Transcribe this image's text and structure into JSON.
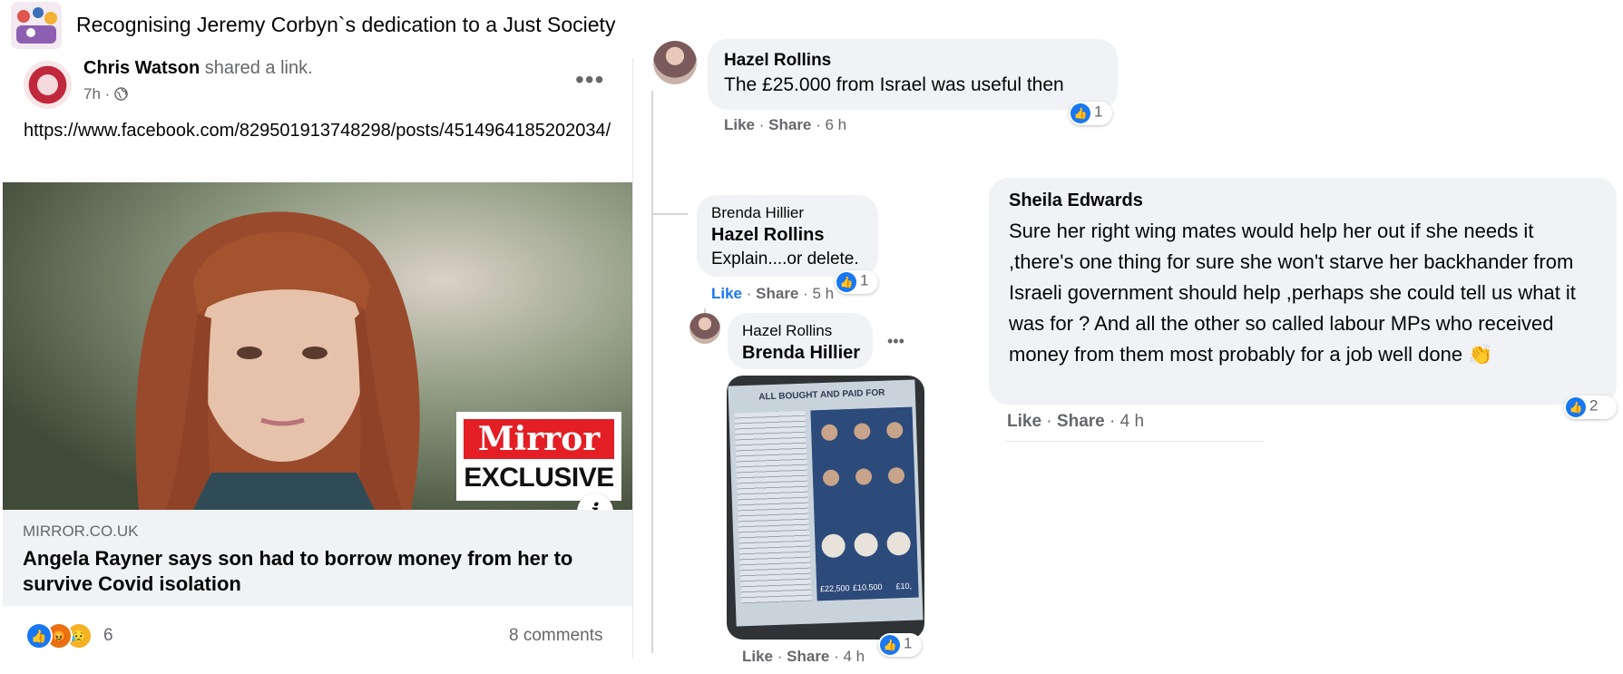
{
  "header": {
    "group_title": "Recognising Jeremy Corbyn`s dedication to a Just Society",
    "group_icon": "group-thumbnail"
  },
  "post": {
    "author": "Chris Watson",
    "action": "shared a link.",
    "time": "7h",
    "privacy_icon": "globe-icon",
    "url_text": "https://www.facebook.com/829501913748298/posts/4514964185202034/",
    "link": {
      "badge_top": "Mirror",
      "badge_bottom": "EXCLUSIVE",
      "domain": "MIRROR.CO.UK",
      "title": "Angela Rayner says son had to borrow money from her to survive Covid isolation"
    },
    "reaction_count": "6",
    "comment_count": "8 comments"
  },
  "comments": {
    "c1": {
      "name": "Hazel Rollins",
      "text": "The £25.000 from Israel was useful then",
      "like_label": "Like",
      "share_label": "Share",
      "time": "6 h",
      "likes": "1"
    },
    "c2": {
      "name": "Brenda Hillier",
      "tag": "Hazel Rollins",
      "text": "Explain....or delete.",
      "like_label": "Like",
      "share_label": "Share",
      "time": "5 h",
      "likes": "1"
    },
    "c3": {
      "name": "Hazel Rollins",
      "tag": "Brenda Hillier",
      "like_label": "Like",
      "share_label": "Share",
      "time": "4 h",
      "likes": "1",
      "photo": {
        "header": "ALL BOUGHT AND PAID FOR",
        "amounts": [
          "£22,500",
          "£10.500",
          "£10,"
        ]
      }
    },
    "c4": {
      "name": "Sheila Edwards",
      "text": "Sure her right wing mates would help her out if she needs it ,there's one thing for sure she won't starve her backhander from Israeli government should help ,perhaps she could tell us what it was for ? And all the other so called labour MPs who received money from them most probably for a job well done 👏",
      "like_label": "Like",
      "share_label": "Share",
      "time": "4 h",
      "likes": "2"
    }
  },
  "colors": {
    "facebook_blue": "#1877f2",
    "bubble_gray": "#f0f2f5",
    "meta_gray": "#65676b",
    "mirror_red": "#e31e24"
  }
}
